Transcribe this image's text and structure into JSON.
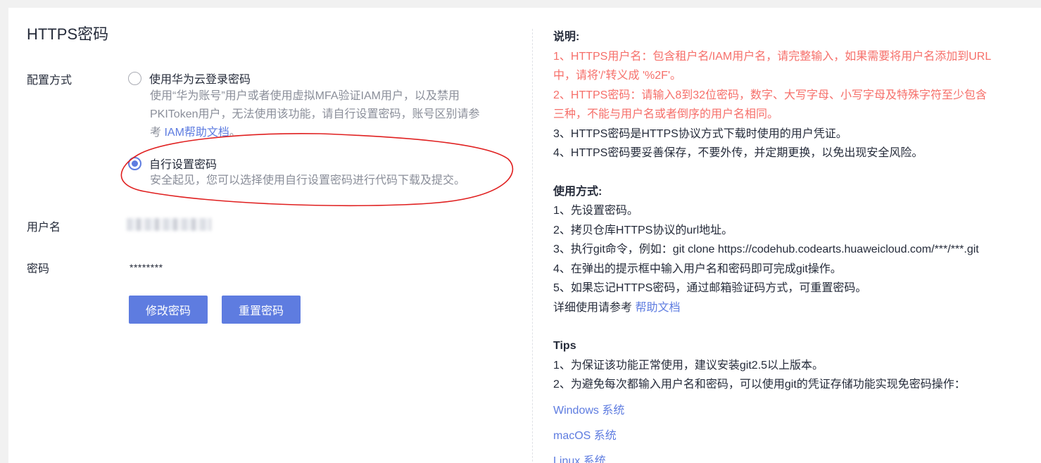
{
  "title": "HTTPS密码",
  "config": {
    "label": "配置方式",
    "option1": {
      "label": "使用华为云登录密码",
      "desc_lines": [
        "使用“华为账号”用户或者使用虚拟MFA验证IAM用户，以及禁用",
        "PKIToken用户，无法使用该功能，请自行设置密码，账号区别请参"
      ],
      "desc_prefix": "考 ",
      "desc_link": "IAM帮助文档",
      "desc_suffix": "。"
    },
    "option2": {
      "label": "自行设置密码",
      "desc": "安全起见，您可以选择使用自行设置密码进行代码下载及提交。"
    },
    "selected": "option2"
  },
  "username": {
    "label": "用户名"
  },
  "password": {
    "label": "密码",
    "value": "********"
  },
  "buttons": {
    "modify": "修改密码",
    "reset": "重置密码"
  },
  "notes": {
    "heading": "说明:",
    "items": [
      "1、HTTPS用户名：包含租户名/IAM用户名，请完整输入，如果需要将用户名添加到URL",
      "中，请将'/'转义成 '%2F'。",
      "2、HTTPS密码：请输入8到32位密码，数字、大写字母、小写字母及特殊字符至少包含",
      "三种，不能与用户名或者倒序的用户名相同。",
      "3、HTTPS密码是HTTPS协议方式下载时使用的用户凭证。",
      "4、HTTPS密码要妥善保存，不要外传，并定期更换，以免出现安全风险。"
    ]
  },
  "usage": {
    "heading": "使用方式:",
    "items": [
      "1、先设置密码。",
      "2、拷贝仓库HTTPS协议的url地址。",
      "3、执行git命令，例如：git clone https://codehub.codearts.huaweicloud.com/***/***.git",
      "4、在弹出的提示框中输入用户名和密码即可完成git操作。",
      "5、如果忘记HTTPS密码，通过邮箱验证码方式，可重置密码。"
    ],
    "detail_prefix": "详细使用请参考 ",
    "detail_link": "帮助文档"
  },
  "tips": {
    "heading": "Tips",
    "items": [
      "1、为保证该功能正常使用，建议安装git2.5以上版本。",
      "2、为避免每次都输入用户名和密码，可以使用git的凭证存储功能实现免密码操作："
    ],
    "links": [
      "Windows 系统",
      "macOS 系统",
      "Linux 系统"
    ]
  },
  "colors": {
    "primary": "#5e7ce0",
    "warning_text": "#f66f6a",
    "annotation": "#e02020"
  }
}
